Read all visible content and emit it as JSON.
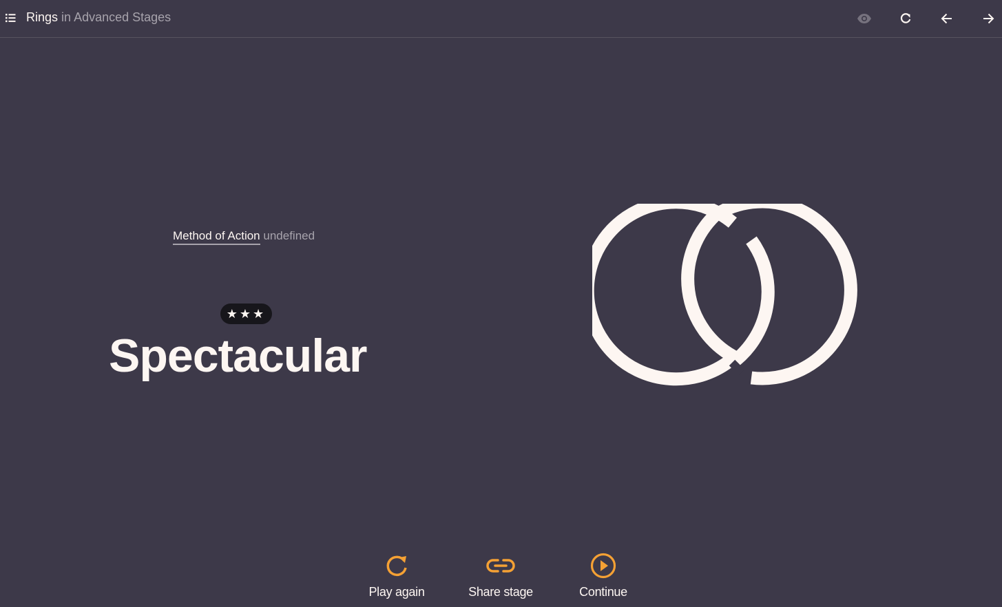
{
  "header": {
    "stage_name": "Rings",
    "separator_text": "in",
    "collection_name": "Advanced Stages",
    "icons": [
      "list-icon",
      "eye-icon",
      "reload-icon",
      "arrow-left-icon",
      "arrow-right-icon"
    ]
  },
  "method": {
    "link_label": "Method of Action",
    "value": "undefined"
  },
  "rating": {
    "stars": "★★★",
    "label": "Spectacular"
  },
  "actions": {
    "play_again": "Play again",
    "share_stage": "Share stage",
    "continue": "Continue"
  },
  "colors": {
    "background": "#3d3949",
    "text": "#fdf6f2",
    "accent": "#f5a134",
    "muted": "#a7a3ac"
  }
}
